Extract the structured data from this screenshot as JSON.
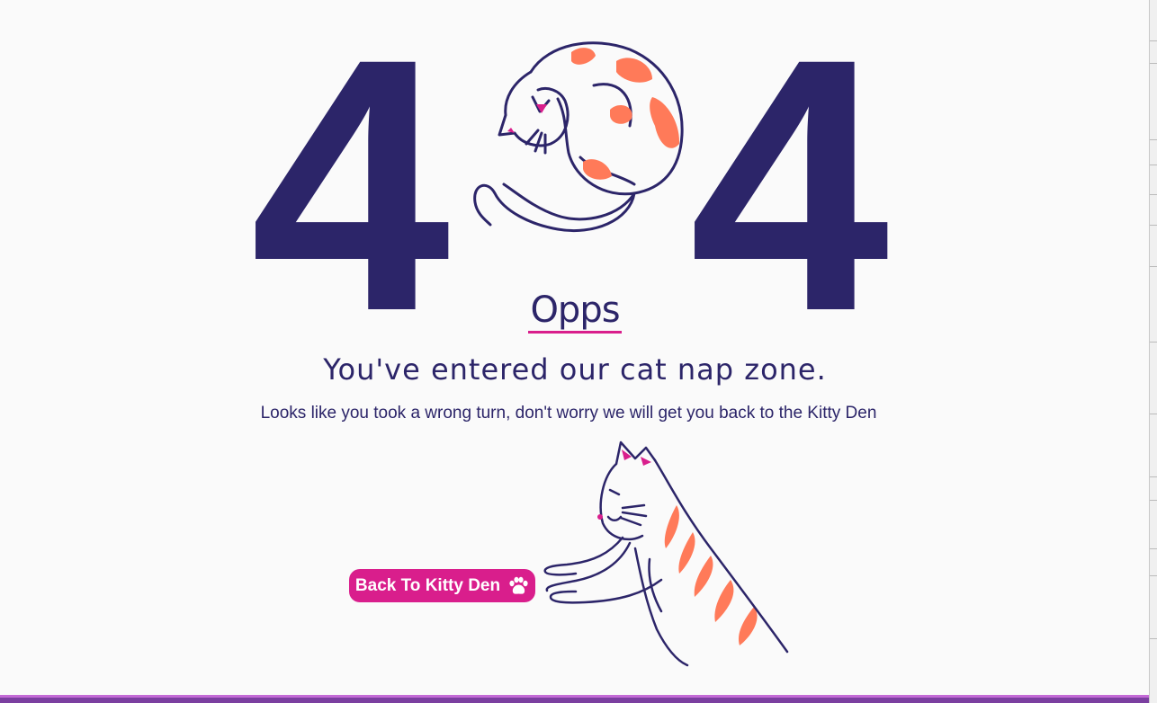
{
  "error_code": {
    "left_digit": "4",
    "right_digit": "4"
  },
  "headline": "Opps",
  "title": "You've entered our cat nap zone.",
  "subtitle": "Looks like you took a wrong turn, don't worry we will get you back to the Kitty Den",
  "back_button": {
    "label": "Back To Kitty Den",
    "icon": "paw-icon"
  },
  "colors": {
    "navy": "#2c2569",
    "pink": "#d91e8c",
    "orange": "#ff7a59",
    "background": "#fafafa"
  }
}
